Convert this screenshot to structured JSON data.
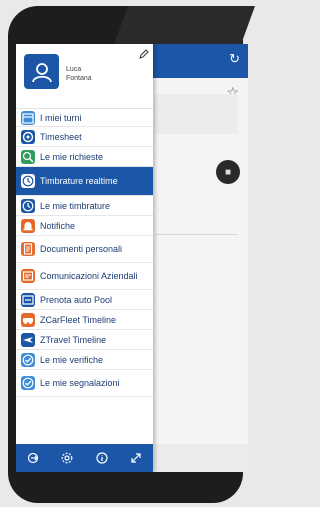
{
  "user": {
    "first_name": "Luca",
    "last_name": "Fontana"
  },
  "menu": [
    {
      "label": "I miei turni",
      "icon": "calendar-icon",
      "color": "#3d8ed8",
      "lines": 1,
      "height": 17
    },
    {
      "label": "Timesheet",
      "icon": "timesheet-icon",
      "color": "#1c56a6",
      "lines": 1,
      "height": 19
    },
    {
      "label": "Le mie richieste",
      "icon": "requests-icon",
      "color": "#2f9e5d",
      "lines": 1,
      "height": 19
    },
    {
      "label": "Timbrature realtime",
      "icon": "clock-icon",
      "color": "#ffffff",
      "lines": 2,
      "height": 28,
      "active": true
    },
    {
      "label": "Le mie timbrature",
      "icon": "clock-icon",
      "color": "#1c56a6",
      "lines": 1,
      "height": 19
    },
    {
      "label": "Notifiche",
      "icon": "bell-icon",
      "color": "#e5672a",
      "lines": 1,
      "height": 19
    },
    {
      "label": "Documenti personali",
      "icon": "document-icon",
      "color": "#e5672a",
      "lines": 2,
      "height": 26
    },
    {
      "label": "Comunicazioni Aziendali",
      "icon": "announcement-icon",
      "color": "#e5672a",
      "lines": 2,
      "height": 26
    },
    {
      "label": "Prenota auto Pool",
      "icon": "car-booking-icon",
      "color": "#1c56a6",
      "lines": 1,
      "height": 19
    },
    {
      "label": "ZCarFleet Timeline",
      "icon": "car-icon",
      "color": "#e5672a",
      "lines": 1,
      "height": 19
    },
    {
      "label": "ZTravel Timeline",
      "icon": "plane-icon",
      "color": "#1c56a6",
      "lines": 1,
      "height": 19
    },
    {
      "label": "Le mie verifiche",
      "icon": "check-icon",
      "color": "#3d8ed8",
      "lines": 1,
      "height": 19
    },
    {
      "label": "Le mie segnalazioni",
      "icon": "report-icon",
      "color": "#3d8ed8",
      "lines": 2,
      "height": 26
    }
  ],
  "bottom_bar": [
    {
      "icon": "logout-icon"
    },
    {
      "icon": "settings-icon"
    },
    {
      "icon": "info-icon"
    },
    {
      "icon": "expand-icon"
    }
  ],
  "colors": {
    "primary": "#1c56a6",
    "accent": "#e5672a"
  }
}
